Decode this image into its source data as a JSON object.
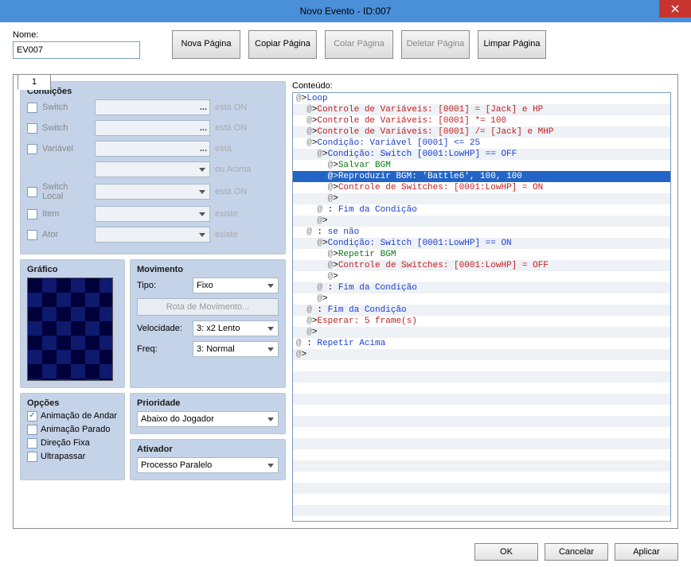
{
  "window": {
    "title": "Novo Evento - ID:007"
  },
  "name": {
    "label": "Nome:",
    "value": "EV007"
  },
  "page_buttons": {
    "new": "Nova\nPágina",
    "copy": "Copiar\nPágina",
    "paste": "Colar\nPágina",
    "delete": "Deletar\nPágina",
    "clear": "Limpar\nPágina"
  },
  "tab": {
    "label": "1"
  },
  "conditions": {
    "title": "Condições",
    "switch1": {
      "label": "Switch",
      "suffix": "está ON"
    },
    "switch2": {
      "label": "Switch",
      "suffix": "está ON"
    },
    "variable": {
      "label": "Variável",
      "suffix": "está",
      "suffix2": "ou Acima"
    },
    "selfswitch": {
      "label": "Switch Local",
      "suffix": "está ON"
    },
    "item": {
      "label": "Item",
      "suffix": "existe"
    },
    "actor": {
      "label": "Ator",
      "suffix": "existe"
    }
  },
  "graphic": {
    "title": "Gráfico"
  },
  "movement": {
    "title": "Movimento",
    "type_label": "Tipo:",
    "type_value": "Fixo",
    "route_btn": "Rota de Movimento...",
    "speed_label": "Velocidade:",
    "speed_value": "3: x2 Lento",
    "freq_label": "Freq:",
    "freq_value": "3: Normal"
  },
  "options": {
    "title": "Opções",
    "walk_anim": "Animação de Andar",
    "step_anim": "Animação Parado",
    "dir_fix": "Direção Fixa",
    "through": "Ultrapassar"
  },
  "priority": {
    "title": "Prioridade",
    "value": "Abaixo do Jogador"
  },
  "trigger": {
    "title": "Ativador",
    "value": "Processo Paralelo"
  },
  "content": {
    "label": "Conteúdo:",
    "lines": [
      {
        "indent": 0,
        "cls": "c-blue",
        "text": "Loop"
      },
      {
        "indent": 1,
        "cls": "c-red",
        "text": "Controle de Variáveis: [0001] = [Jack] e HP"
      },
      {
        "indent": 1,
        "cls": "c-red",
        "text": "Controle de Variáveis: [0001] *= 100"
      },
      {
        "indent": 1,
        "cls": "c-red",
        "text": "Controle de Variáveis: [0001] /= [Jack] e MHP"
      },
      {
        "indent": 1,
        "cls": "c-blue",
        "text": "Condição: Variável [0001] <= 25"
      },
      {
        "indent": 2,
        "cls": "c-blue",
        "text": "Condição: Switch [0001:LowHP] == OFF"
      },
      {
        "indent": 3,
        "cls": "c-green",
        "text": "Salvar BGM"
      },
      {
        "indent": 3,
        "cls": "c-green",
        "text": "Reproduzir BGM: 'Battle6', 100, 100",
        "selected": true
      },
      {
        "indent": 3,
        "cls": "c-red",
        "text": "Controle de Switches: [0001:LowHP] = ON"
      },
      {
        "indent": 3,
        "cls": "",
        "text": ""
      },
      {
        "indent": 2,
        "cls": "c-blue",
        "colon": true,
        "text": " Fim da Condição"
      },
      {
        "indent": 2,
        "cls": "",
        "text": ""
      },
      {
        "indent": 1,
        "cls": "c-blue",
        "colon": true,
        "text": " se não"
      },
      {
        "indent": 2,
        "cls": "c-blue",
        "text": "Condição: Switch [0001:LowHP] == ON"
      },
      {
        "indent": 3,
        "cls": "c-green",
        "text": "Repetir BGM"
      },
      {
        "indent": 3,
        "cls": "c-red",
        "text": "Controle de Switches: [0001:LowHP] = OFF"
      },
      {
        "indent": 3,
        "cls": "",
        "text": ""
      },
      {
        "indent": 2,
        "cls": "c-blue",
        "colon": true,
        "text": " Fim da Condição"
      },
      {
        "indent": 2,
        "cls": "",
        "text": ""
      },
      {
        "indent": 1,
        "cls": "c-blue",
        "colon": true,
        "text": " Fim da Condição"
      },
      {
        "indent": 1,
        "cls": "c-red",
        "text": "Esperar: 5 frame(s)"
      },
      {
        "indent": 1,
        "cls": "",
        "text": ""
      },
      {
        "indent": 0,
        "cls": "c-blue",
        "colon": true,
        "text": " Repetir Acima"
      },
      {
        "indent": 0,
        "cls": "",
        "text": "",
        "empty": true
      }
    ]
  },
  "buttons": {
    "ok": "OK",
    "cancel": "Cancelar",
    "apply": "Aplicar"
  }
}
